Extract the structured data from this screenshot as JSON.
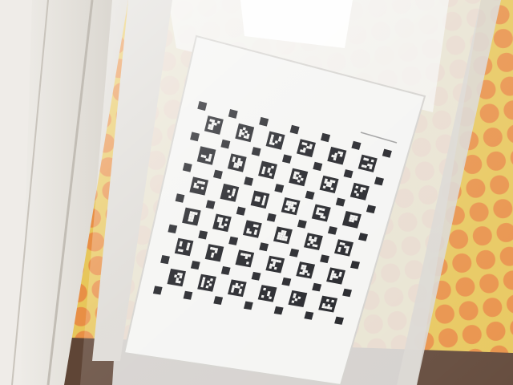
{
  "scene": {
    "colors": {
      "wall_yellow": "#e7c65a",
      "dot_orange": "#e88f45",
      "door_panel": "#e9e6e1",
      "glass_frame": "#dedbd6",
      "board_white": "#f4f4f2",
      "marker_black": "#15161b",
      "floor": "#5f4536"
    },
    "board": {
      "grid_columns": 6,
      "grid_rows": 6,
      "marker_count": 36,
      "footnote_present": true
    }
  }
}
